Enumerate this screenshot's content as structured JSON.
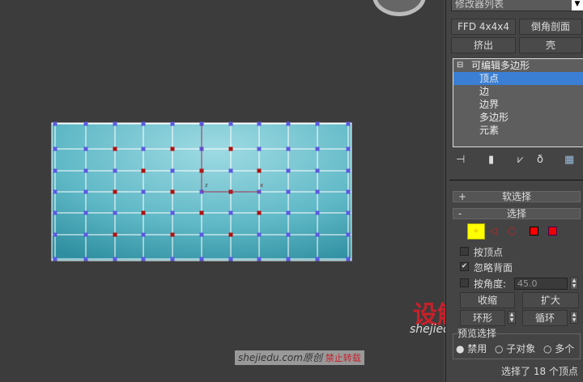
{
  "modifier_list": "修改器列表",
  "buttons": {
    "ffd": "FFD 4x4x4",
    "bevel_profile": "倒角剖面",
    "extrude": "挤出",
    "shell": "壳"
  },
  "stack": {
    "root": "可编辑多边形",
    "items": [
      "顶点",
      "边",
      "边界",
      "多边形",
      "元素"
    ],
    "selected": "顶点"
  },
  "rollouts": {
    "soft_selection": {
      "sign": "+",
      "label": "软选择"
    },
    "selection": {
      "sign": "-",
      "label": "选择"
    }
  },
  "selection": {
    "by_vertex": {
      "label": "按顶点",
      "checked": false
    },
    "ignore_backfacing": {
      "label": "忽略背面",
      "checked": true
    },
    "by_angle": {
      "label": "按角度:",
      "checked": false,
      "value": "45.0"
    },
    "shrink": "收缩",
    "grow": "扩大",
    "ring": "环形",
    "loop": "循环",
    "preview_title": "预览选择",
    "preview_options": [
      {
        "label": "禁用",
        "selected": true
      },
      {
        "label": "子对象",
        "selected": false
      },
      {
        "label": "多个",
        "selected": false
      }
    ],
    "status": "选择了 18 个顶点"
  },
  "watermark": {
    "logo": "设解读",
    "logo_sub": "shejiedu.com",
    "caption_site": "shejiedu.com原创",
    "caption_warn": "禁止转载"
  },
  "colors": {
    "mesh": "#5fb8c6",
    "vertex": "#5a5ae0",
    "selected_vertex": "#b01010",
    "selection_highlight": "#3a7fd4"
  },
  "viewport": {
    "gizmo_labels": {
      "z": "z",
      "x": "x"
    }
  }
}
